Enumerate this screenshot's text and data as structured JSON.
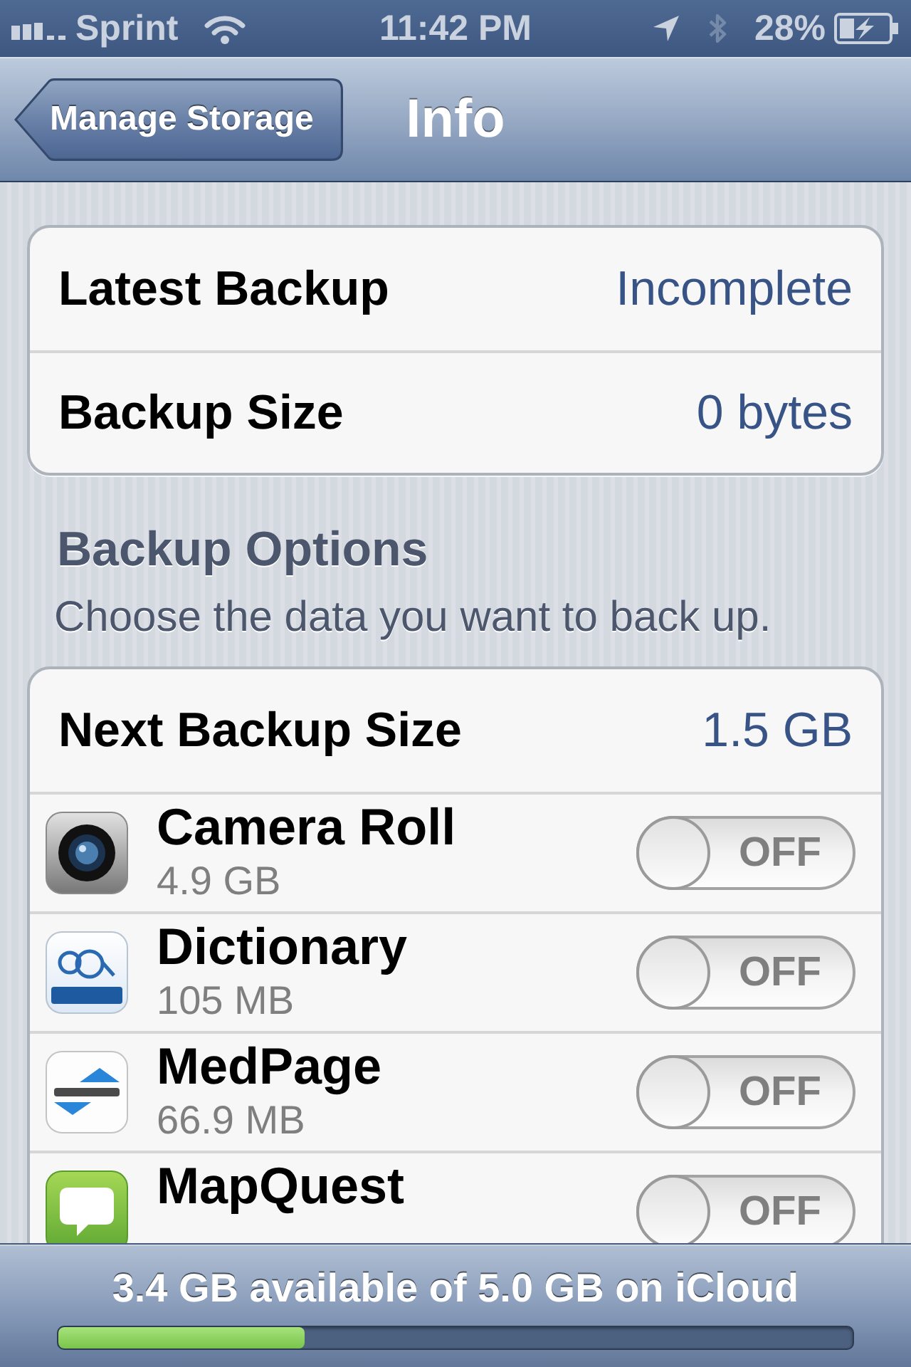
{
  "status_bar": {
    "carrier": "Sprint",
    "time": "11:42 PM",
    "battery": "28%"
  },
  "nav_bar": {
    "back_button": "Manage Storage",
    "title": "Info"
  },
  "backup_info": [
    {
      "label": "Latest Backup",
      "value": "Incomplete"
    },
    {
      "label": "Backup Size",
      "value": "0 bytes"
    }
  ],
  "backup_options": {
    "header": "Backup Options",
    "description": "Choose the data you want to back up.",
    "summary": {
      "label": "Next Backup Size",
      "value": "1.5 GB"
    },
    "apps": [
      {
        "name": "Camera Roll",
        "size": "4.9 GB",
        "kind": "camera",
        "on": false,
        "switch_label": "OFF"
      },
      {
        "name": "Dictionary",
        "size": "105 MB",
        "kind": "glasses",
        "on": false,
        "switch_label": "OFF"
      },
      {
        "name": "MedPage",
        "size": "66.9 MB",
        "kind": "triangles",
        "on": false,
        "switch_label": "OFF"
      },
      {
        "name": "MapQuest",
        "kind": "bubble",
        "on": false,
        "switch_label": "OFF"
      }
    ]
  },
  "storage": {
    "text": "3.4 GB available of 5.0 GB on iCloud",
    "level": 0.31
  }
}
